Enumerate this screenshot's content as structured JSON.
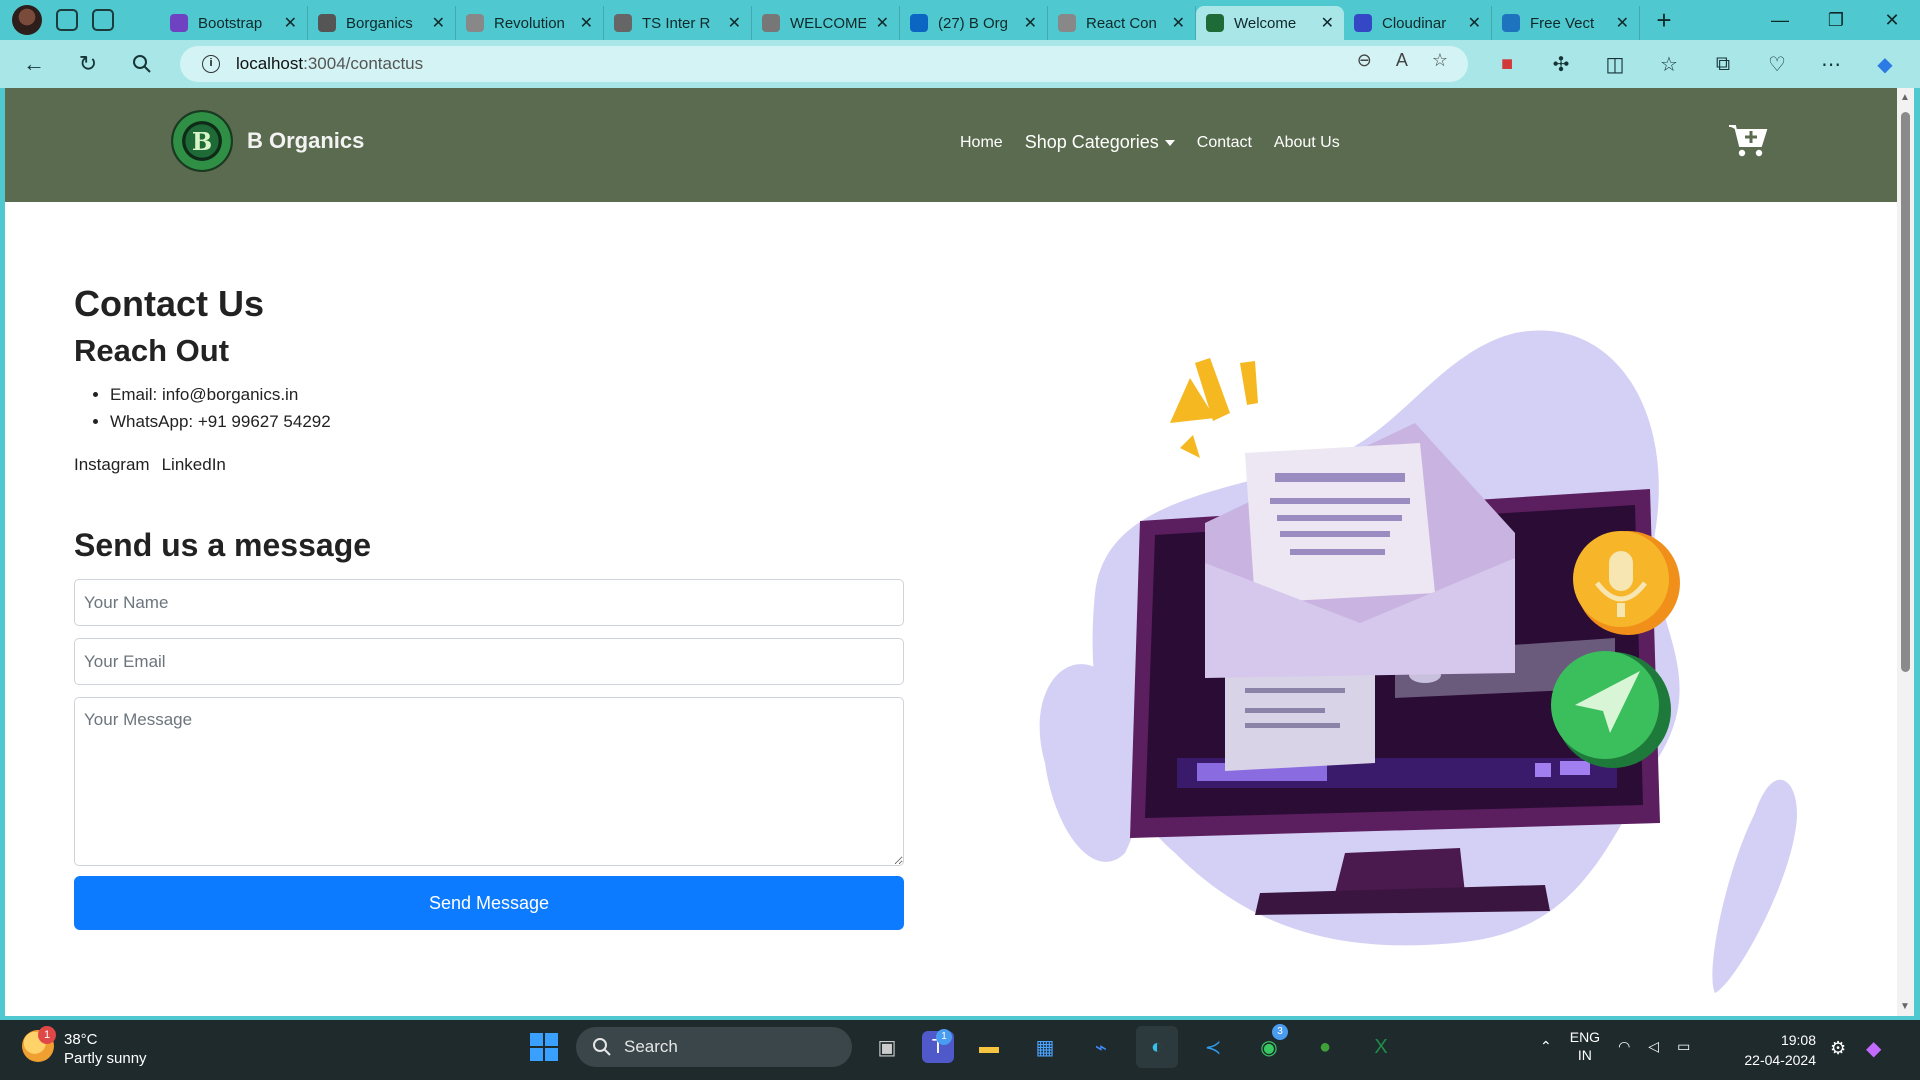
{
  "browser": {
    "tabs": [
      {
        "title": "Bootstrap",
        "color": "#6f42c1",
        "active": false
      },
      {
        "title": "Borganics",
        "color": "#555",
        "active": false
      },
      {
        "title": "Revolution",
        "color": "#888",
        "active": false
      },
      {
        "title": "TS Inter R",
        "color": "#666",
        "active": false
      },
      {
        "title": "WELCOME",
        "color": "#777",
        "active": false
      },
      {
        "title": "(27) B Org",
        "color": "#0a66c2",
        "active": false
      },
      {
        "title": "React Con",
        "color": "#888",
        "active": false
      },
      {
        "title": "Welcome",
        "color": "#1f6b37",
        "active": true
      },
      {
        "title": "Cloudinar",
        "color": "#3448c5",
        "active": false
      },
      {
        "title": "Free Vect",
        "color": "#1e73be",
        "active": false
      }
    ],
    "url_host": "localhost",
    "url_path": ":3004/contactus"
  },
  "site": {
    "brand_name": "B Organics",
    "logo_letter": "B",
    "nav": {
      "home": "Home",
      "shop": "Shop Categories",
      "contact": "Contact",
      "about": "About Us"
    }
  },
  "page": {
    "title": "Contact Us",
    "reach_heading": "Reach Out",
    "email": "Email: info@borganics.in",
    "whatsapp": "WhatsApp: +91 99627 54292",
    "social": [
      "Instagram",
      "LinkedIn"
    ],
    "send_heading": "Send us a message",
    "form": {
      "name_placeholder": "Your Name",
      "email_placeholder": "Your Email",
      "message_placeholder": "Your Message",
      "submit_label": "Send Message"
    }
  },
  "taskbar": {
    "weather_temp": "38°C",
    "weather_desc": "Partly sunny",
    "weather_badge": "1",
    "search_label": "Search",
    "teams_badge": "1",
    "whatsapp_badge": "3",
    "lang_top": "ENG",
    "lang_bottom": "IN",
    "time": "19:08",
    "date": "22-04-2024"
  }
}
